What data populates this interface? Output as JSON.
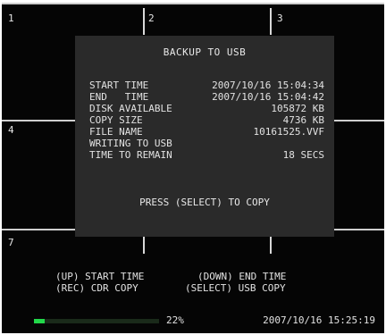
{
  "cameras": [
    "1",
    "2",
    "3",
    "4",
    "7"
  ],
  "dialog": {
    "title": "BACKUP TO USB",
    "rows": [
      {
        "label": "START TIME",
        "value": "2007/10/16 15:04:34"
      },
      {
        "label": "END   TIME",
        "value": "2007/10/16 15:04:42"
      },
      {
        "label": "DISK AVAILABLE",
        "value": "105872 KB"
      },
      {
        "label": "COPY SIZE",
        "value": "4736 KB"
      },
      {
        "label": "FILE NAME",
        "value": "10161525.VVF"
      },
      {
        "label": "WRITING TO USB",
        "value": ""
      },
      {
        "label": "TIME TO REMAIN",
        "value": "18 SECS"
      }
    ],
    "press": "PRESS (SELECT) TO COPY"
  },
  "help": {
    "up_start": "(UP) START TIME",
    "down_end": "(DOWN) END TIME",
    "rec_cdr": "(REC) CDR COPY",
    "select_usb": "(SELECT) USB COPY"
  },
  "status": {
    "progress_percent": 22,
    "progress_text": "22%",
    "datetime": "2007/10/16 15:25:19",
    "accent_color": "#22d84a"
  }
}
